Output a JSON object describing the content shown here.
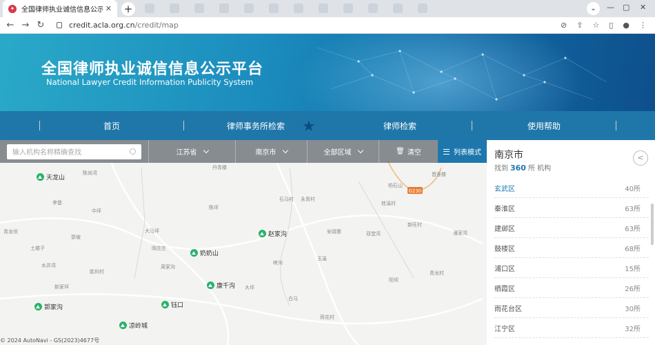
{
  "browser": {
    "tab_title": "全国律师执业诚信信息公示平台",
    "new_tab": "+",
    "url_domain": "credit.acla.org.cn",
    "url_path": "/credit/map"
  },
  "hero": {
    "title": "全国律师执业诚信信息公示平台",
    "subtitle": "National Lawyer Credit Information Publicity System"
  },
  "nav": {
    "items": [
      "首页",
      "律师事务所检索",
      "律师检索",
      "使用帮助"
    ]
  },
  "toolbar": {
    "search_placeholder": "输入机构名称精确查找",
    "province": "江苏省",
    "city": "南京市",
    "area": "全部区域",
    "clear": "清空",
    "list_mode": "列表模式"
  },
  "panel": {
    "city": "南京市",
    "found_prefix": "找到",
    "found_count": "360",
    "found_suffix": "所 机构",
    "districts": [
      {
        "name": "玄武区",
        "count": "40所"
      },
      {
        "name": "秦淮区",
        "count": "63所"
      },
      {
        "name": "建邺区",
        "count": "63所"
      },
      {
        "name": "鼓楼区",
        "count": "68所"
      },
      {
        "name": "浦口区",
        "count": "15所"
      },
      {
        "name": "栖霞区",
        "count": "26所"
      },
      {
        "name": "雨花台区",
        "count": "30所"
      },
      {
        "name": "江宁区",
        "count": "32所"
      }
    ]
  },
  "map": {
    "pois": [
      "天龙山",
      "赵家沟",
      "奶奶山",
      "康千沟",
      "郭家沟",
      "钰口",
      "凉岭城"
    ],
    "labels": [
      "陈尚湾",
      "丹青楼",
      "柏石山",
      "晋莲楼",
      "李堡",
      "中坪",
      "陈坪",
      "永青村",
      "石马村",
      "桂溪村",
      "青龙坝",
      "郭坡",
      "大马坪",
      "晓庄庄",
      "土楼子",
      "安靖寨",
      "双堂湾",
      "新旺村",
      "潘家湾",
      "玉溪",
      "水井湾",
      "胜利村",
      "周家沟",
      "峡沟",
      "青龙村",
      "新家坪",
      "大坪",
      "阳坝",
      "白马",
      "荷花村"
    ],
    "road_label": "G230",
    "copyright": "© 2024 AutoNavi - GS(2023)4677号"
  }
}
